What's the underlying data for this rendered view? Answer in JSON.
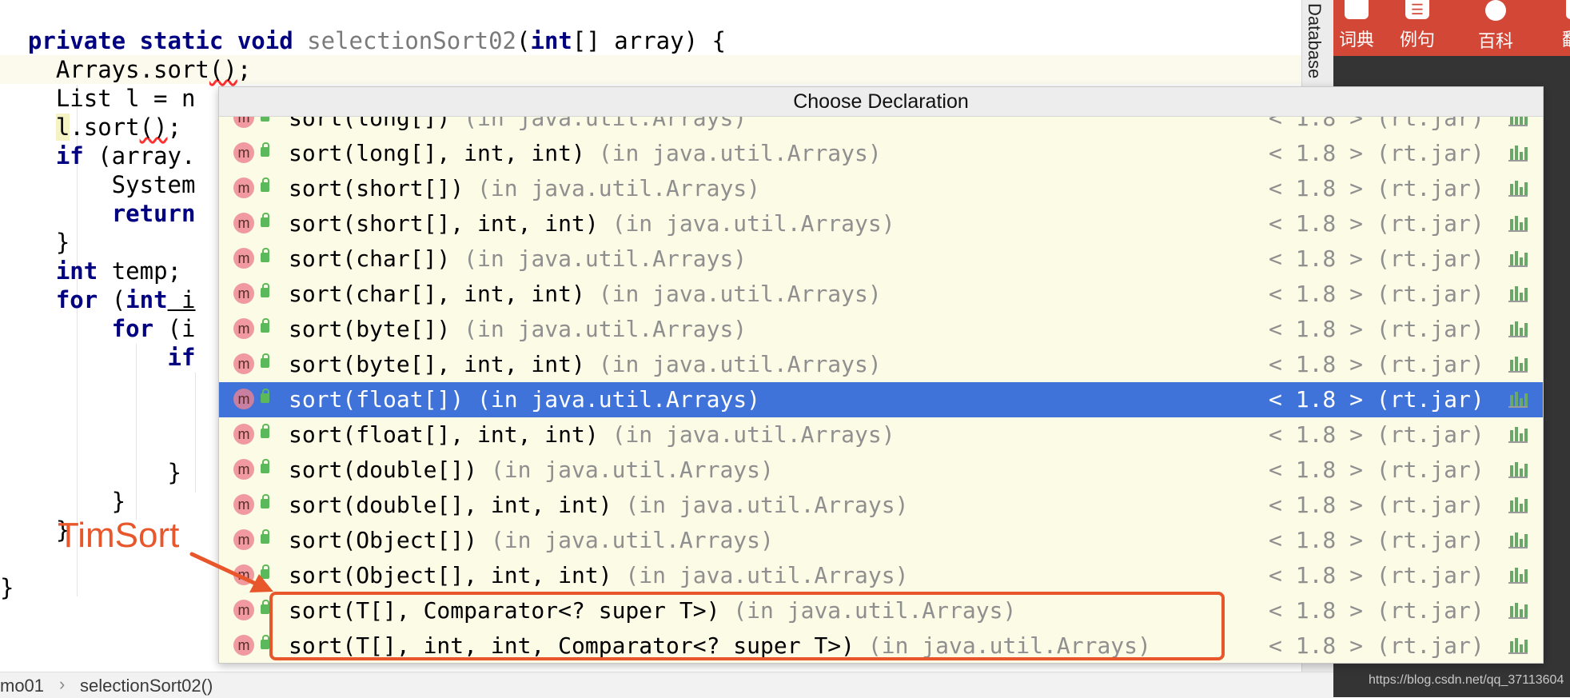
{
  "editor": {
    "lines": {
      "l1": {
        "kw": "private static void",
        "fn": "selectionSort02",
        "open": "(",
        "type": "int",
        "rest": "[] array) {"
      },
      "l2": {
        "pre": "    Arrays.sort",
        "err": "()",
        "post": ";"
      },
      "l3": {
        "text": "    List l = n"
      },
      "l4": {
        "pre": "    ",
        "obj": "l",
        "mid": ".sort",
        "err": "()",
        "post": ";"
      },
      "l5": {
        "pre": "    ",
        "kw": "if",
        "rest": " (array."
      },
      "l6": {
        "text": "        System"
      },
      "l7": {
        "pre": "        ",
        "kw": "return"
      },
      "l8": {
        "text": "    }"
      },
      "l9": {
        "pre": "    ",
        "kw": "int",
        "rest": " temp;"
      },
      "l10": {
        "pre": "    ",
        "kw": "for",
        "open": " (",
        "kw2": "int",
        "rest": " i"
      },
      "l11": {
        "pre": "        ",
        "kw": "for",
        "rest": " (i"
      },
      "l12": {
        "pre": "            ",
        "kw": "if"
      },
      "l13": {
        "text": "            }"
      },
      "l14": {
        "text": "        }"
      },
      "l15": {
        "text": "    }"
      },
      "l16": {
        "text": "}"
      }
    }
  },
  "breadcrumb": {
    "item1": "mo01",
    "separator": "›",
    "item2": "selectionSort02()"
  },
  "side_tool": {
    "label": "Database"
  },
  "dict_bar": {
    "items": [
      {
        "label": "词典",
        "icon": "book-icon"
      },
      {
        "label": "例句",
        "icon": "list-icon"
      },
      {
        "label": "百科",
        "icon": "globe-icon"
      },
      {
        "label": "翻",
        "icon": "translate-icon"
      }
    ]
  },
  "popup": {
    "title": "Choose Declaration",
    "icon_letter": "m",
    "version": "< 1.8 > (rt.jar)",
    "rows": [
      {
        "sig": "sort(long[])",
        "loc": " (in java.util.Arrays)"
      },
      {
        "sig": "sort(long[], int, int)",
        "loc": " (in java.util.Arrays)"
      },
      {
        "sig": "sort(short[])",
        "loc": " (in java.util.Arrays)"
      },
      {
        "sig": "sort(short[], int, int)",
        "loc": " (in java.util.Arrays)"
      },
      {
        "sig": "sort(char[])",
        "loc": " (in java.util.Arrays)"
      },
      {
        "sig": "sort(char[], int, int)",
        "loc": " (in java.util.Arrays)"
      },
      {
        "sig": "sort(byte[])",
        "loc": " (in java.util.Arrays)"
      },
      {
        "sig": "sort(byte[], int, int)",
        "loc": " (in java.util.Arrays)"
      },
      {
        "sig": "sort(float[])",
        "loc": " (in java.util.Arrays)"
      },
      {
        "sig": "sort(float[], int, int)",
        "loc": " (in java.util.Arrays)"
      },
      {
        "sig": "sort(double[])",
        "loc": " (in java.util.Arrays)"
      },
      {
        "sig": "sort(double[], int, int)",
        "loc": " (in java.util.Arrays)"
      },
      {
        "sig": "sort(Object[])",
        "loc": " (in java.util.Arrays)"
      },
      {
        "sig": "sort(Object[], int, int)",
        "loc": " (in java.util.Arrays)"
      },
      {
        "sig": "sort(T[], Comparator<? super T>)",
        "loc": " (in java.util.Arrays)"
      },
      {
        "sig": "sort(T[], int, int, Comparator<? super T>)",
        "loc": " (in java.util.Arrays)"
      }
    ]
  },
  "annotation": {
    "label": "TimSort",
    "color": "#e8562b"
  },
  "watermark": "https://blog.csdn.net/qq_37113604",
  "colors": {
    "selection": "#3f73d9",
    "keyword": "#000080",
    "popup_bg": "#fbfbe6",
    "dict_bar": "#d34736"
  }
}
